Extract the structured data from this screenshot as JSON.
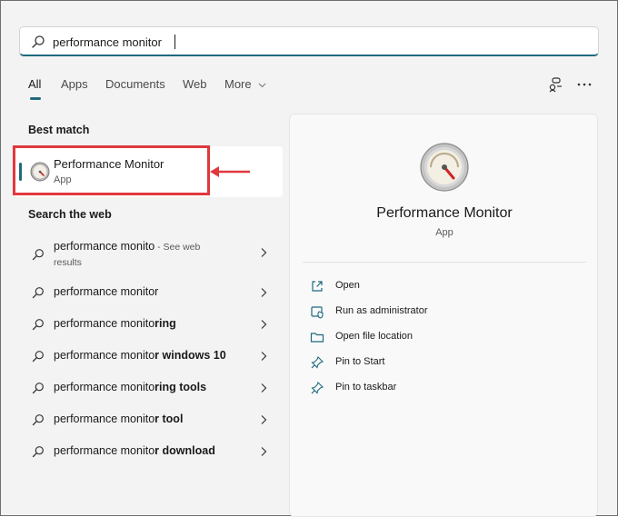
{
  "search": {
    "value": "performance monitor",
    "icon": "search-icon"
  },
  "tabs": [
    {
      "label": "All",
      "active": true
    },
    {
      "label": "Apps"
    },
    {
      "label": "Documents"
    },
    {
      "label": "Web"
    },
    {
      "label": "More"
    }
  ],
  "best_match": {
    "heading": "Best match",
    "name": "Performance Monitor",
    "type": "App"
  },
  "web": {
    "heading": "Search the web",
    "items": [
      {
        "normal": "performance monito",
        "bold": "",
        "suffix": " - See web",
        "sub": "results"
      },
      {
        "normal": "performance monito",
        "bold": "r"
      },
      {
        "normal": "performance monito",
        "bold": "ring"
      },
      {
        "normal": "performance monito",
        "bold": "r windows 10"
      },
      {
        "normal": "performance monito",
        "bold": "ring tools"
      },
      {
        "normal": "performance monito",
        "bold": "r tool"
      },
      {
        "normal": "performance monito",
        "bold": "r download"
      }
    ]
  },
  "preview": {
    "title": "Performance Monitor",
    "subtitle": "App",
    "actions": [
      {
        "label": "Open",
        "icon": "open-icon"
      },
      {
        "label": "Run as administrator",
        "icon": "run-as-admin-icon"
      },
      {
        "label": "Open file location",
        "icon": "folder-icon"
      },
      {
        "label": "Pin to Start",
        "icon": "pin-icon"
      },
      {
        "label": "Pin to taskbar",
        "icon": "pin-icon"
      }
    ]
  },
  "colors": {
    "accent": "#1f6a7e",
    "highlight": "#e0383e"
  }
}
